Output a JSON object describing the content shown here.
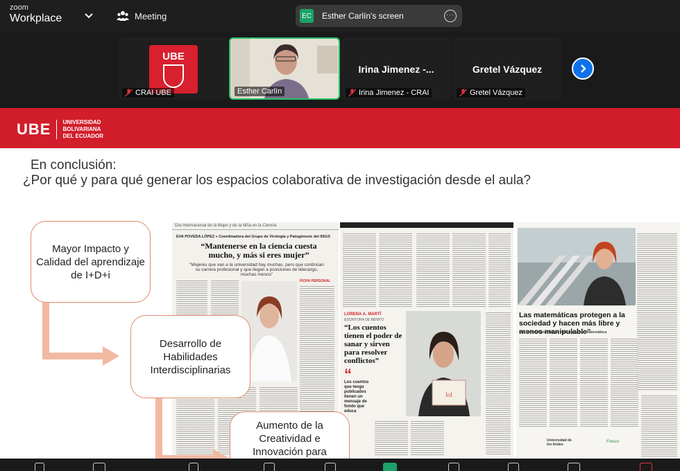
{
  "app": {
    "brand_top": "zoom",
    "brand_bottom": "Workplace"
  },
  "topbar": {
    "meeting_label": "Meeting",
    "screen_badge": "EC",
    "screen_label": "Esther Carlín's screen"
  },
  "participants": [
    {
      "label": "CRAI UBE",
      "muted": true
    },
    {
      "label": "Esther Carlín",
      "muted": false
    },
    {
      "name": "Irina Jimenez -...",
      "label": "Irina Jimenez - CRAI",
      "muted": true
    },
    {
      "name": "Gretel Vázquez",
      "label": "Gretel Vázquez",
      "muted": true
    }
  ],
  "slide": {
    "logo": "UBE",
    "logo_sub": [
      "UNIVERSIDAD",
      "BOLIVARIANA",
      "DEL ECUADOR"
    ],
    "heading_line1": "En conclusión:",
    "heading_line2": "¿Por qué y para qué generar los espacios colaborativa de investigación desde el aula?",
    "boxes": [
      "Mayor Impacto y Calidad del aprendizaje de I+D+i",
      "Desarrollo de Habilidades Interdisciplinarias",
      "Aumento de la Creatividad e Innovación para"
    ],
    "articles": {
      "a1_header": "Día Internacional de la Mujer y de la Niña en la Ciencia",
      "a1_byline": "EVA POVEDA LÓPEZ » Coordinadora del Grupo de Virología y Patogénesis del IISGS",
      "a1_title": "“Mantenerse en la ciencia cuesta mucho, y más si eres mujer”",
      "a1_sub": "“Mujeres que van a la universidad hay muchas, pero que continúan su carrera profesional y que llegan a posiciones de liderazgo, muchas menos”",
      "a1_tag": "FICHA PERSONAL",
      "a2_author": "LORENA A. MARTÍ",
      "a2_role": "ESCRITORA DE BENITO",
      "a2_title": "“Los cuentos tienen el poder de sanar y sirven para resolver conflictos”",
      "a2_pull": "Los cuentos que tengo publicados tienen un mensaje de fondo que educa",
      "a3_title": "Las matemáticas protegen a la sociedad y hacen más libre y menos manipulable”",
      "a3_byline": "ara Grima  Catedrática y divulgadora matemática",
      "a3_footer1": "Universidad de los Andes",
      "a3_footer2": "Fresco"
    }
  },
  "colors": {
    "ube_red": "#d21d2a",
    "accent_blue": "#0e71eb",
    "active_green": "#2ac26a",
    "box_border": "#e08a68"
  }
}
